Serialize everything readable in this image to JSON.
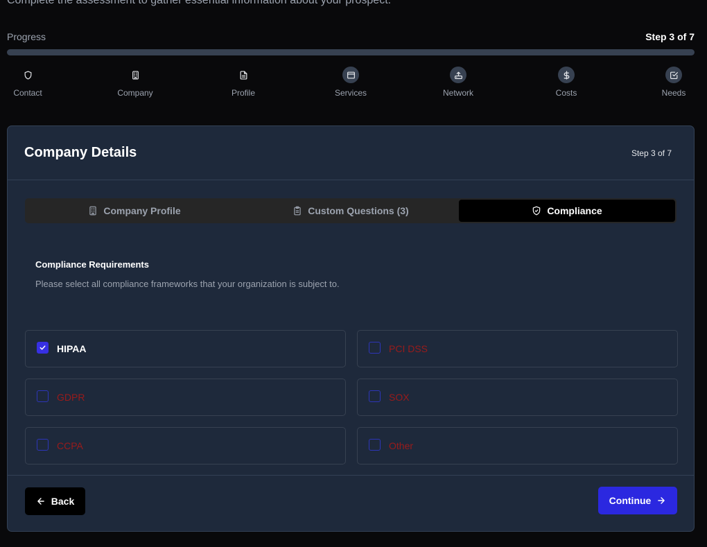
{
  "header": {
    "subtitle": "Complete the assessment to gather essential information about your prospect."
  },
  "progress": {
    "label": "Progress",
    "step_text": "Step 3 of 7",
    "percent": 0
  },
  "steps": [
    {
      "label": "Contact",
      "icon": "shield-icon",
      "done": false
    },
    {
      "label": "Company",
      "icon": "building-icon",
      "done": false
    },
    {
      "label": "Profile",
      "icon": "file-text-icon",
      "done": false
    },
    {
      "label": "Services",
      "icon": "browser-window-icon",
      "done": true
    },
    {
      "label": "Network",
      "icon": "router-icon",
      "done": true
    },
    {
      "label": "Costs",
      "icon": "dollar-icon",
      "done": true
    },
    {
      "label": "Needs",
      "icon": "check-square-icon",
      "done": true
    }
  ],
  "card": {
    "title": "Company Details",
    "step_text": "Step 3 of 7"
  },
  "tabs": [
    {
      "label": "Company Profile",
      "icon": "building-icon",
      "active": false
    },
    {
      "label": "Custom Questions (3)",
      "icon": "clipboard-icon",
      "active": false
    },
    {
      "label": "Compliance",
      "icon": "shield-check-icon",
      "active": true
    }
  ],
  "section": {
    "title": "Compliance Requirements",
    "description": "Please select all compliance frameworks that your organization is subject to."
  },
  "options": [
    {
      "label": "HIPAA",
      "checked": true
    },
    {
      "label": "PCI DSS",
      "checked": false
    },
    {
      "label": "GDPR",
      "checked": false
    },
    {
      "label": "SOX",
      "checked": false
    },
    {
      "label": "CCPA",
      "checked": false
    },
    {
      "label": "Other",
      "checked": false
    }
  ],
  "footer": {
    "back_label": "Back",
    "continue_label": "Continue"
  },
  "colors": {
    "accent": "#2b28e0",
    "unchecked_label": "#991b1b",
    "card_bg": "#1e293b"
  }
}
